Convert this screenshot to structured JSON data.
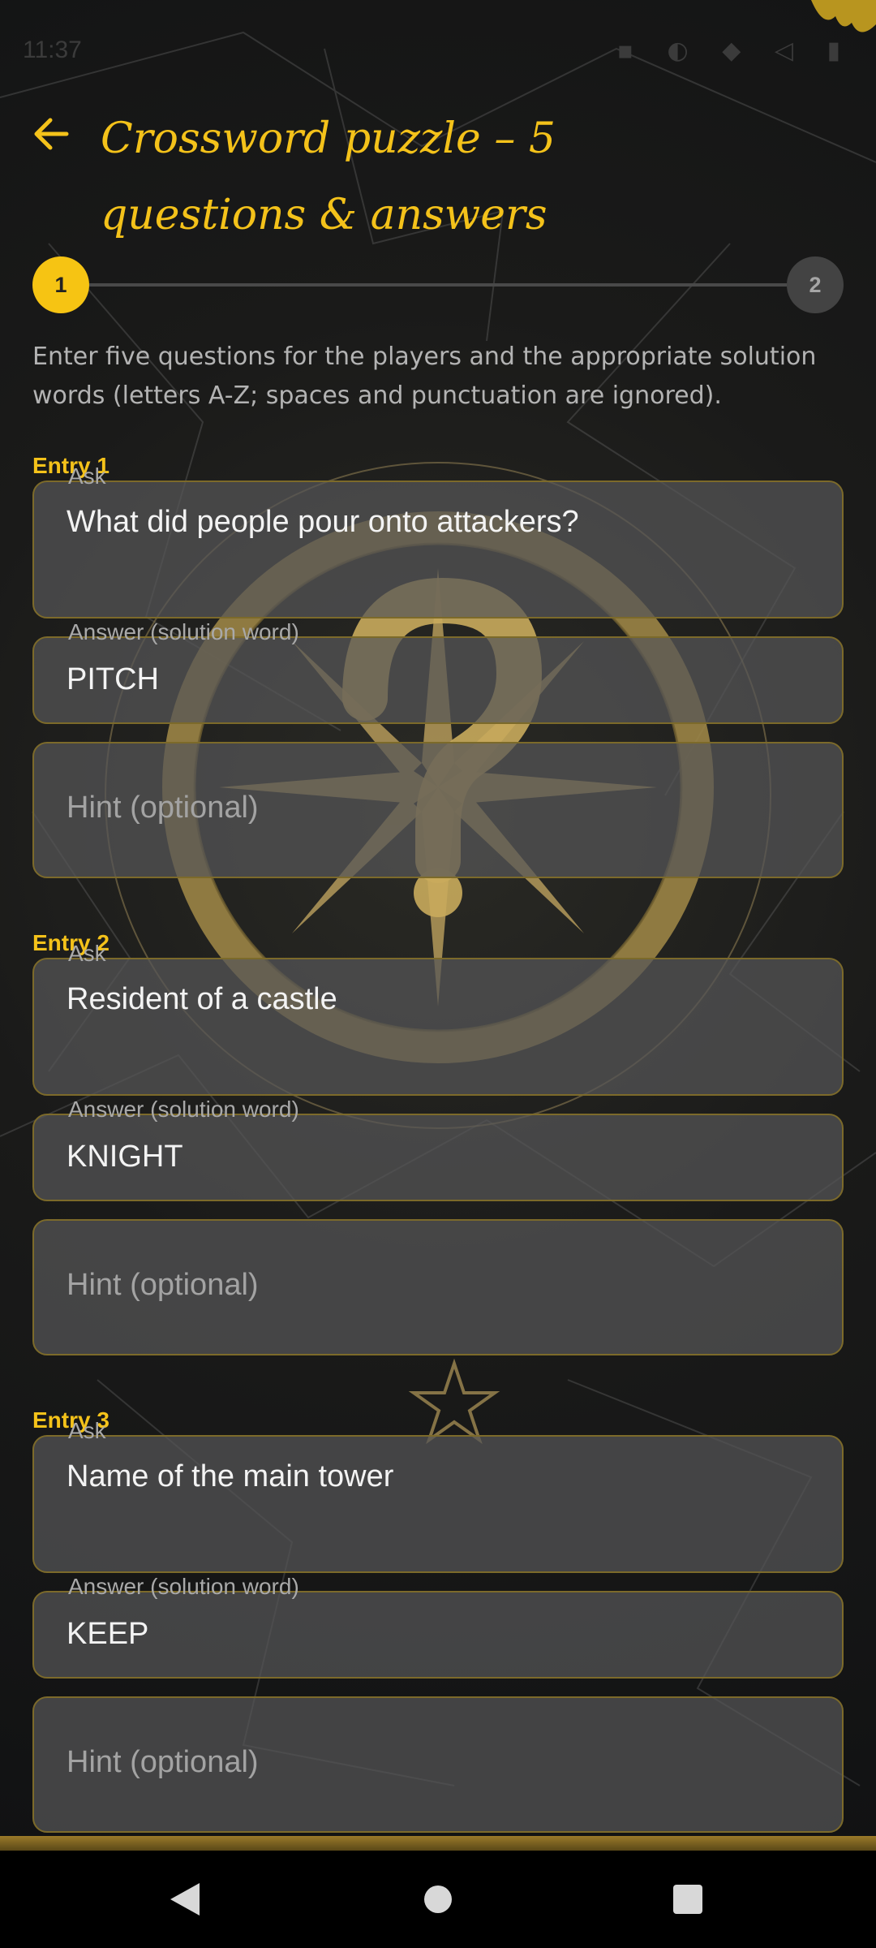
{
  "status_bar": {
    "time": "11:37",
    "right": "▪ ◐ ◆ ◁ ▮"
  },
  "header": {
    "title": "Crossword puzzle – 5 questions & answers"
  },
  "stepper": {
    "step1": "1",
    "step2": "2"
  },
  "intro": "Enter five questions for the players and the appropriate solution words (letters A-Z; spaces and punctuation are ignored).",
  "entries": [
    {
      "label": "Entry 1",
      "ask_label": "Ask",
      "ask": "What did people pour onto attackers?",
      "answer_label": "Answer (solution word)",
      "answer": "PITCH",
      "hint_placeholder": "Hint (optional)"
    },
    {
      "label": "Entry 2",
      "ask_label": "Ask",
      "ask": "Resident of a castle",
      "answer_label": "Answer (solution word)",
      "answer": "KNIGHT",
      "hint_placeholder": "Hint (optional)"
    },
    {
      "label": "Entry 3",
      "ask_label": "Ask",
      "ask": "Name of the main tower",
      "answer_label": "Answer (solution word)",
      "answer": "KEEP",
      "hint_placeholder": "Hint (optional)"
    }
  ],
  "colors": {
    "accent": "#f4c21a",
    "field_border": "#7c6a2a",
    "background": "#121314"
  },
  "icons": {
    "back": "arrow-left-icon",
    "nav_back": "triangle-back-icon",
    "nav_home": "circle-home-icon",
    "nav_recents": "square-recents-icon"
  }
}
